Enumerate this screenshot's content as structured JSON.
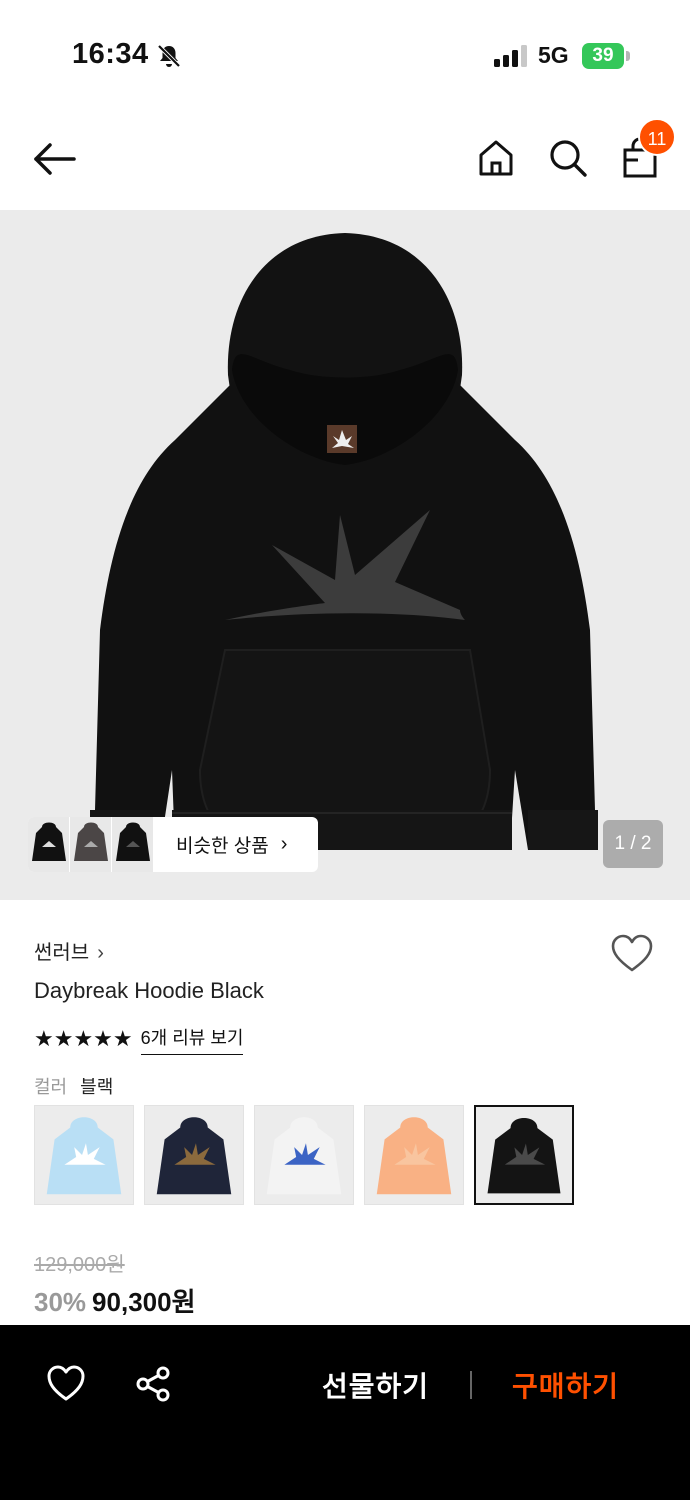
{
  "status_bar": {
    "time": "16:34",
    "network": "5G",
    "battery": "39"
  },
  "header": {
    "cart_count": "11"
  },
  "gallery": {
    "similar_label": "비슷한 상품",
    "page_indicator": "1 / 2"
  },
  "product": {
    "brand": "썬러브",
    "name": "Daybreak Hoodie Black",
    "stars": "★★★★★",
    "rating": 5,
    "review_link": "6개 리뷰 보기",
    "color_label": "컬러",
    "color_value": "블랙",
    "swatches": [
      {
        "name": "sky blue",
        "color": "#b9dff5",
        "emblem": "#ffffff"
      },
      {
        "name": "navy",
        "color": "#1f2539",
        "emblem": "#8b6a3d"
      },
      {
        "name": "white",
        "color": "#f3f3f3",
        "emblem": "#3b63c4"
      },
      {
        "name": "peach",
        "color": "#f9b184",
        "emblem": "#f9c59f"
      },
      {
        "name": "black",
        "color": "#141414",
        "emblem": "#4a4a4a",
        "selected": true
      }
    ],
    "original_price": "129,000원",
    "discount": "30%",
    "sale_price": "90,300원"
  },
  "bottom_bar": {
    "gift_label": "선물하기",
    "buy_label": "구매하기"
  },
  "colors": {
    "accent": "#ff5000",
    "badge": "#ff5000",
    "battery": "#34c759"
  },
  "icons": [
    "bell-off-icon",
    "signal-icon",
    "battery-icon",
    "back-arrow-icon",
    "home-icon",
    "search-icon",
    "shopping-bag-icon",
    "heart-icon",
    "share-icon",
    "chevron-right-icon",
    "star-icon"
  ]
}
